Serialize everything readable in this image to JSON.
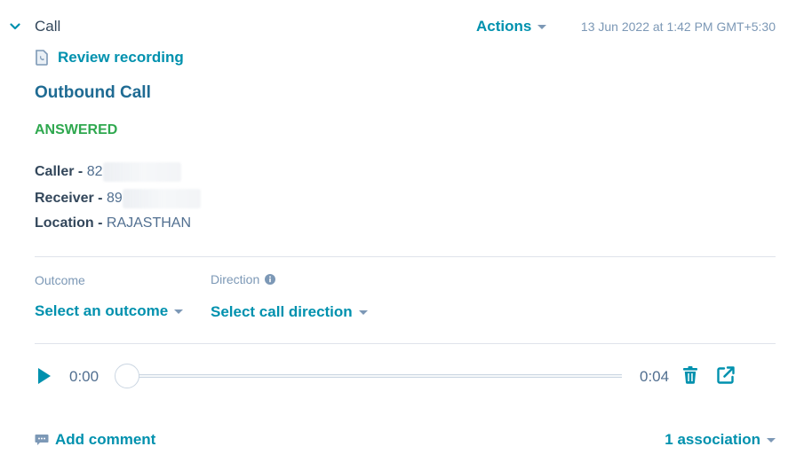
{
  "header": {
    "title": "Call",
    "actions_label": "Actions",
    "timestamp": "13 Jun 2022 at 1:42 PM GMT+5:30"
  },
  "review_recording_label": "Review recording",
  "call_title": "Outbound Call",
  "call_status": "ANSWERED",
  "details": {
    "caller_key": "Caller -",
    "caller_value": "82",
    "receiver_key": "Receiver -",
    "receiver_value": "89",
    "location_key": "Location -",
    "location_value": "RAJASTHAN"
  },
  "fields": {
    "outcome_label": "Outcome",
    "outcome_value": "Select an outcome",
    "direction_label": "Direction",
    "direction_value": "Select call direction"
  },
  "player": {
    "current_time": "0:00",
    "total_time": "0:04",
    "progress": 0
  },
  "footer": {
    "add_comment_label": "Add comment",
    "association_label": "1 association"
  },
  "colors": {
    "accent": "#0091ae",
    "title_blue": "#1f6b93",
    "status_green": "#2fa84f",
    "text": "#33475b",
    "muted": "#7c98b6"
  }
}
